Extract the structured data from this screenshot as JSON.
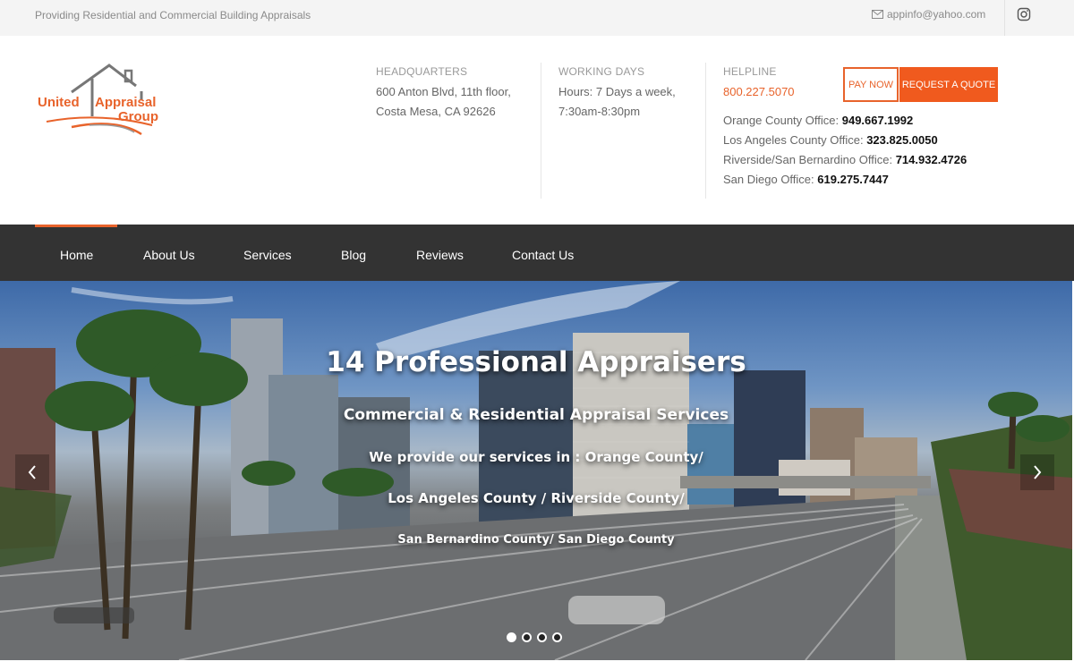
{
  "topbar": {
    "tagline": "Providing Residential and Commercial Building Appraisals",
    "email": "appinfo@yahoo.com",
    "email_icon": "envelope-icon",
    "social_icon": "instagram-icon"
  },
  "logo": {
    "line1_left": "United",
    "line1_right": "Appraisal",
    "line2": "Group"
  },
  "headquarters": {
    "label": "HEADQUARTERS",
    "line1": "600 Anton Blvd, 11th floor,",
    "line2": "Costa Mesa, CA 92626"
  },
  "working_days": {
    "label": "WORKING DAYS",
    "line1": "Hours: 7 Days a week,",
    "line2": "7:30am-8:30pm"
  },
  "helpline": {
    "label": "HELPLINE",
    "number": "800.227.5070"
  },
  "offices": [
    {
      "name": "Orange County Office:",
      "phone": "949.667.1992"
    },
    {
      "name": "Los Angeles County Office:",
      "phone": "323.825.0050"
    },
    {
      "name": "Riverside/San Bernardino Office:",
      "phone": "714.932.4726"
    },
    {
      "name": "San Diego Office:",
      "phone": "619.275.7447"
    }
  ],
  "buttons": {
    "pay_now": "PAY NOW",
    "request_quote": "REQUEST A QUOTE"
  },
  "nav": {
    "items": [
      "Home",
      "About Us",
      "Services",
      "Blog",
      "Reviews",
      "Contact Us"
    ],
    "active": "Home"
  },
  "hero": {
    "title": "14 Professional Appraisers",
    "subtitle": "Commercial & Residential Appraisal Services",
    "line3": "We provide our services in : Orange County/",
    "line4": "Los Angeles County / Riverside County/",
    "line5": "San Bernardino County/ San Diego County",
    "slide_count": 4,
    "active_slide": 1
  },
  "colors": {
    "accent": "#e8632b",
    "nav_bg": "#333333",
    "topbar_bg": "#f4f4f4"
  }
}
